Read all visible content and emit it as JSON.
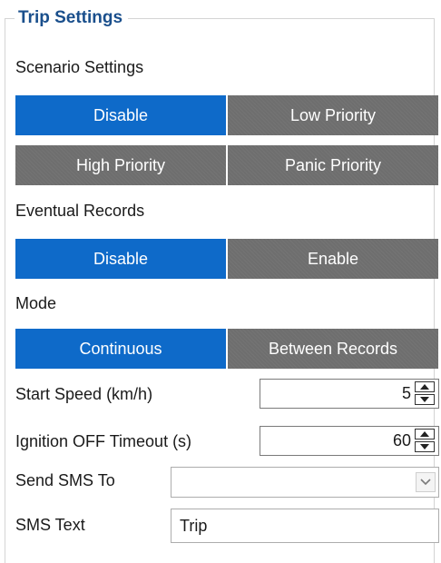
{
  "group": {
    "title": "Trip Settings"
  },
  "scenario": {
    "label": "Scenario Settings",
    "options": [
      "Disable",
      "Low Priority",
      "High Priority",
      "Panic Priority"
    ],
    "selected": "Disable"
  },
  "eventual": {
    "label": "Eventual Records",
    "options": [
      "Disable",
      "Enable"
    ],
    "selected": "Disable"
  },
  "mode": {
    "label": "Mode",
    "options": [
      "Continuous",
      "Between Records"
    ],
    "selected": "Continuous"
  },
  "start_speed": {
    "label": "Start Speed (km/h)",
    "value": "5"
  },
  "ignition_timeout": {
    "label": "Ignition OFF Timeout (s)",
    "value": "60"
  },
  "send_sms": {
    "label": "Send SMS To",
    "value": ""
  },
  "sms_text": {
    "label": "SMS Text",
    "value": "Trip"
  },
  "colors": {
    "accent": "#0e6ac9",
    "inactive": "#6e6e6e",
    "legend": "#1a4f8c"
  }
}
